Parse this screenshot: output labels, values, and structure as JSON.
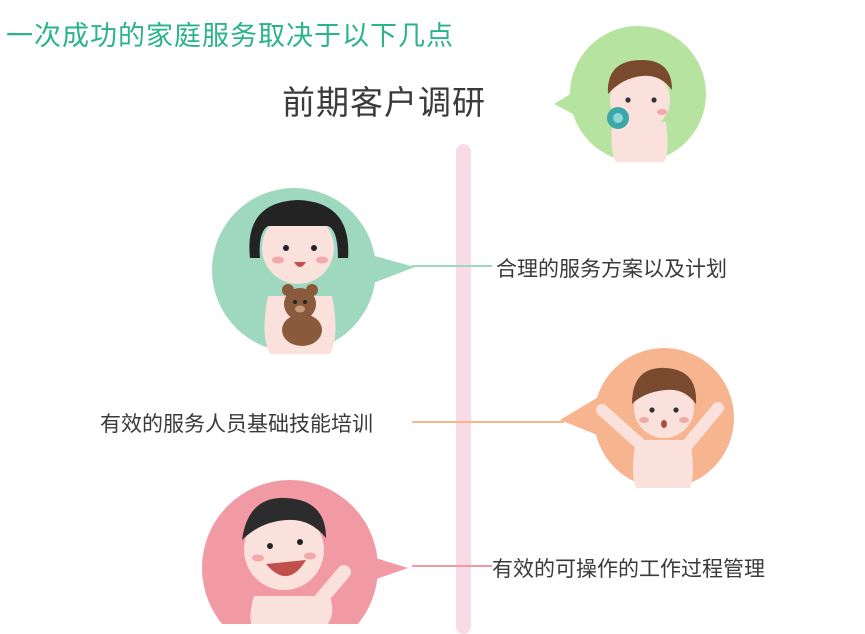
{
  "header": {
    "title": "一次成功的家庭服务取决于以下几点",
    "subtitle": "前期客户调研"
  },
  "items": [
    {
      "text": "合理的服务方案以及计划",
      "color": "#9ed8bf"
    },
    {
      "text": "有效的服务人员基础技能培训",
      "color": "#f7b58f"
    },
    {
      "text": "有效的可操作的工作过程管理",
      "color": "#f29aa3"
    }
  ],
  "colors": {
    "title": "#2bb38a",
    "timeline": "#f9dbe7",
    "top_bubble": "#b7e3a0",
    "text": "#3a3a3a"
  }
}
